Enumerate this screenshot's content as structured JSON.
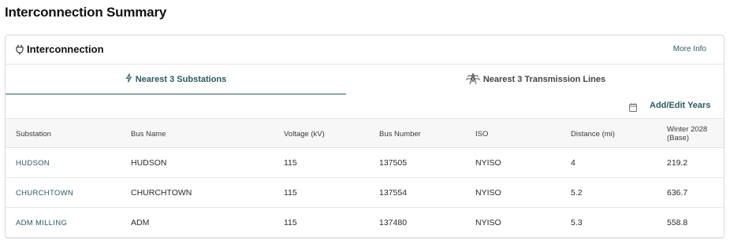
{
  "page": {
    "title": "Interconnection Summary"
  },
  "card": {
    "title": "Interconnection",
    "more_info_label": "More Info"
  },
  "tabs": [
    {
      "label": "Nearest 3 Substations",
      "icon": "lightning-icon",
      "active": true
    },
    {
      "label": "Nearest 3 Transmission Lines",
      "icon": "transmission-tower-icon",
      "active": false
    }
  ],
  "toolbar": {
    "add_edit_label": "Add/Edit Years",
    "icon": "calendar-icon"
  },
  "table": {
    "columns": [
      "Substation",
      "Bus Name",
      "Voltage (kV)",
      "Bus Number",
      "ISO",
      "Distance (mi)",
      "Winter 2028 (Base)"
    ],
    "rows": [
      {
        "substation": "HUDSON",
        "bus_name": "HUDSON",
        "voltage": "115",
        "bus_number": "137505",
        "iso": "NYISO",
        "distance": "4",
        "winter_2028": "219.2"
      },
      {
        "substation": "CHURCHTOWN",
        "bus_name": "CHURCHTOWN",
        "voltage": "115",
        "bus_number": "137554",
        "iso": "NYISO",
        "distance": "5.2",
        "winter_2028": "636.7"
      },
      {
        "substation": "ADM MILLING",
        "bus_name": "ADM",
        "voltage": "115",
        "bus_number": "137480",
        "iso": "NYISO",
        "distance": "5.3",
        "winter_2028": "558.8"
      }
    ]
  },
  "colors": {
    "accent": "#2b5a61",
    "border": "#d9d9d9",
    "header_bg": "#f7f7f7"
  }
}
